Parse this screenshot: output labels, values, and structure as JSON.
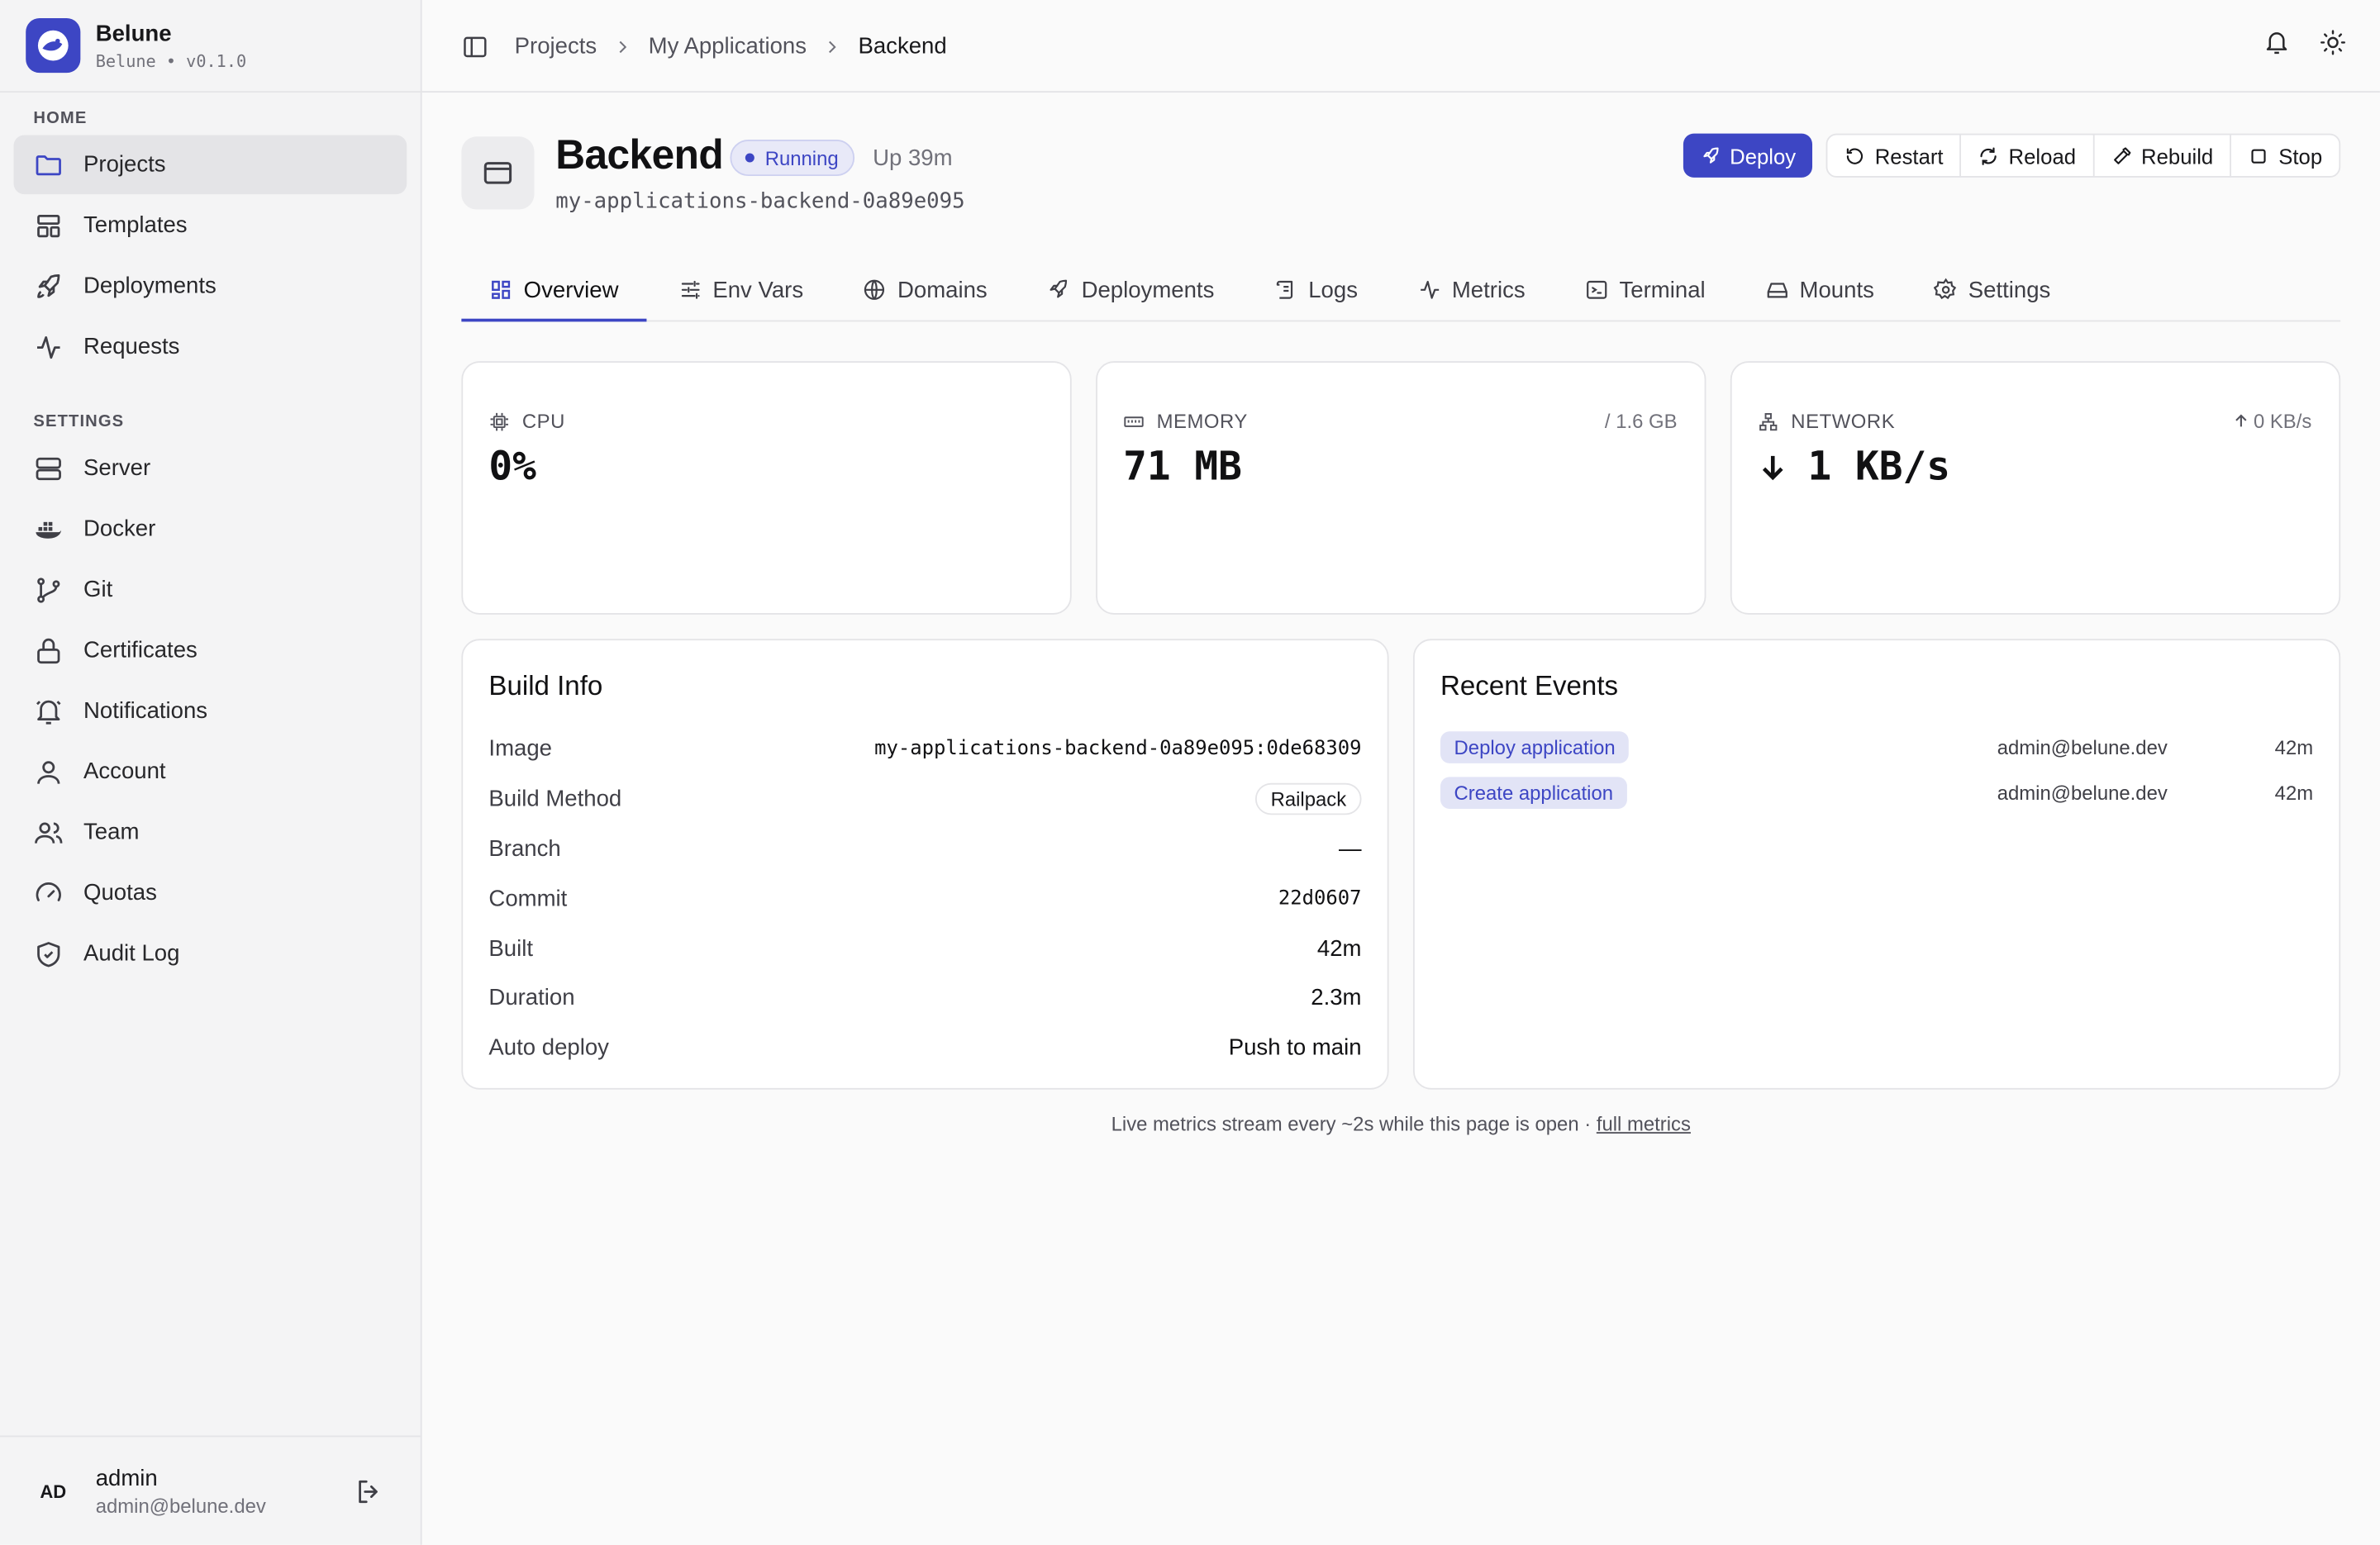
{
  "brand": {
    "name": "Belune",
    "subtitle": "Belune • v0.1.0"
  },
  "sidebar": {
    "home_title": "HOME",
    "home_items": [
      {
        "label": "Projects",
        "icon": "folder-icon",
        "active": true
      },
      {
        "label": "Templates",
        "icon": "layout-icon"
      },
      {
        "label": "Deployments",
        "icon": "rocket-icon"
      },
      {
        "label": "Requests",
        "icon": "activity-icon"
      }
    ],
    "settings_title": "SETTINGS",
    "settings_items": [
      {
        "label": "Server",
        "icon": "server-icon"
      },
      {
        "label": "Docker",
        "icon": "docker-icon"
      },
      {
        "label": "Git",
        "icon": "git-branch-icon"
      },
      {
        "label": "Certificates",
        "icon": "lock-icon"
      },
      {
        "label": "Notifications",
        "icon": "bell-ring-icon"
      },
      {
        "label": "Account",
        "icon": "user-icon"
      },
      {
        "label": "Team",
        "icon": "users-icon"
      },
      {
        "label": "Quotas",
        "icon": "gauge-icon"
      },
      {
        "label": "Audit Log",
        "icon": "shield-check-icon"
      }
    ]
  },
  "user": {
    "initials": "AD",
    "name": "admin",
    "email": "admin@belune.dev"
  },
  "breadcrumb": {
    "items": [
      "Projects",
      "My Applications",
      "Backend"
    ]
  },
  "app": {
    "title": "Backend",
    "status": "Running",
    "uptime": "Up 39m",
    "slug": "my-applications-backend-0a89e095"
  },
  "actions": {
    "deploy": "Deploy",
    "restart": "Restart",
    "reload": "Reload",
    "rebuild": "Rebuild",
    "stop": "Stop"
  },
  "tabs": [
    "Overview",
    "Env Vars",
    "Domains",
    "Deployments",
    "Logs",
    "Metrics",
    "Terminal",
    "Mounts",
    "Settings"
  ],
  "metrics": {
    "cpu": {
      "label": "CPU",
      "value": "0%"
    },
    "memory": {
      "label": "MEMORY",
      "value": "71 MB",
      "limit": "/ 1.6 GB"
    },
    "network": {
      "label": "NETWORK",
      "value": "1 KB/s",
      "up": "0 KB/s"
    }
  },
  "build_info": {
    "title": "Build Info",
    "rows": [
      {
        "key": "Image",
        "value": "my-applications-backend-0a89e095:0de68309"
      },
      {
        "key": "Build Method",
        "value": "Railpack"
      },
      {
        "key": "Branch",
        "value": "—"
      },
      {
        "key": "Commit",
        "value": "22d0607"
      },
      {
        "key": "Built",
        "value": "42m"
      },
      {
        "key": "Duration",
        "value": "2.3m"
      },
      {
        "key": "Auto deploy",
        "value": "Push to main"
      }
    ]
  },
  "events": {
    "title": "Recent Events",
    "items": [
      {
        "action": "Deploy application",
        "user": "admin@belune.dev",
        "time": "42m"
      },
      {
        "action": "Create application",
        "user": "admin@belune.dev",
        "time": "42m"
      }
    ]
  },
  "footer": {
    "text": "Live metrics stream every ~2s while this page is open · ",
    "link": "full metrics"
  },
  "colors": {
    "accent": "#3d46c4",
    "sidebar_bg": "#f4f4f5",
    "page_bg": "#fafafa"
  }
}
